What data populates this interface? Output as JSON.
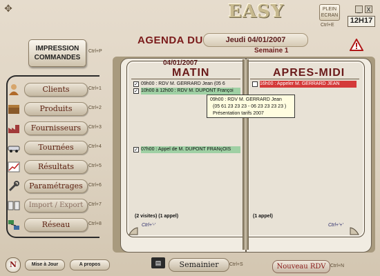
{
  "app": {
    "logo": "EASY",
    "plein_ecran": [
      "PLEIN",
      "ECRAN"
    ],
    "plein_ecran_shortcut": "Ctrl+E",
    "minimize": "_",
    "close": "X",
    "clock": "12H17",
    "corner_icon": "move-icon"
  },
  "header": {
    "agenda_label": "AGENDA DU",
    "date": "Jeudi 04/01/2007",
    "week": "Semaine 1"
  },
  "impression": {
    "line1": "IMPRESSION",
    "line2": "COMMANDES",
    "shortcut": "Ctrl+P"
  },
  "sidebar": {
    "items": [
      {
        "label": "Clients",
        "shortcut": "Ctrl+1",
        "icon": "person-icon"
      },
      {
        "label": "Produits",
        "shortcut": "Ctrl+2",
        "icon": "box-icon"
      },
      {
        "label": "Fournisseurs",
        "shortcut": "Ctrl+3",
        "icon": "factory-icon"
      },
      {
        "label": "Tournées",
        "shortcut": "Ctrl+4",
        "icon": "car-icon"
      },
      {
        "label": "Résultats",
        "shortcut": "Ctrl+5",
        "icon": "chart-icon"
      },
      {
        "label": "Paramétrages",
        "shortcut": "Ctrl+6",
        "icon": "wrench-icon"
      },
      {
        "label": "Import / Export",
        "shortcut": "Ctrl+7",
        "icon": "transfer-icon"
      },
      {
        "label": "Réseau",
        "shortcut": "Ctrl+8",
        "icon": "network-icon"
      }
    ]
  },
  "agenda": {
    "page_date": "04/01/2007",
    "matin_title": "MATIN",
    "apres_title": "APRES-MIDI",
    "matin_entries": [
      {
        "text": "09h00 : RDV M. GERRARD Jean      (05 6",
        "checked": true,
        "style": "plain"
      },
      {
        "text": "10h00 à 12h00 : RDV M. DUPONT Françoi",
        "checked": true,
        "style": "green"
      },
      {
        "text": "07h00 : Appel de  M. DUPONT FRANçOIS",
        "checked": true,
        "style": "green"
      }
    ],
    "apres_entries": [
      {
        "text": "16h00 : Appeler  M. GERRARD JEAN",
        "checked": false,
        "style": "red"
      }
    ],
    "matin_footer": "(2 visites) (1 appel)",
    "apres_footer": "(1 appel)",
    "matin_ctrl": "Ctrl+'-'",
    "apres_ctrl": "Ctrl+'+'",
    "tooltip": [
      "09h00 : RDV M. GERRARD Jean",
      "(05 61 23 23 23  - 06 23 23 23 23  )",
      "Présentation tarifs 2007"
    ]
  },
  "bottom": {
    "n_label": "N",
    "mise_a_jour": "Mise à Jour",
    "a_propos": "A propos",
    "semainier": "Semainier",
    "semainier_shortcut": "Ctrl+S",
    "nouveau_rdv": "Nouveau RDV",
    "nouveau_rdv_shortcut": "Ctrl+N"
  }
}
